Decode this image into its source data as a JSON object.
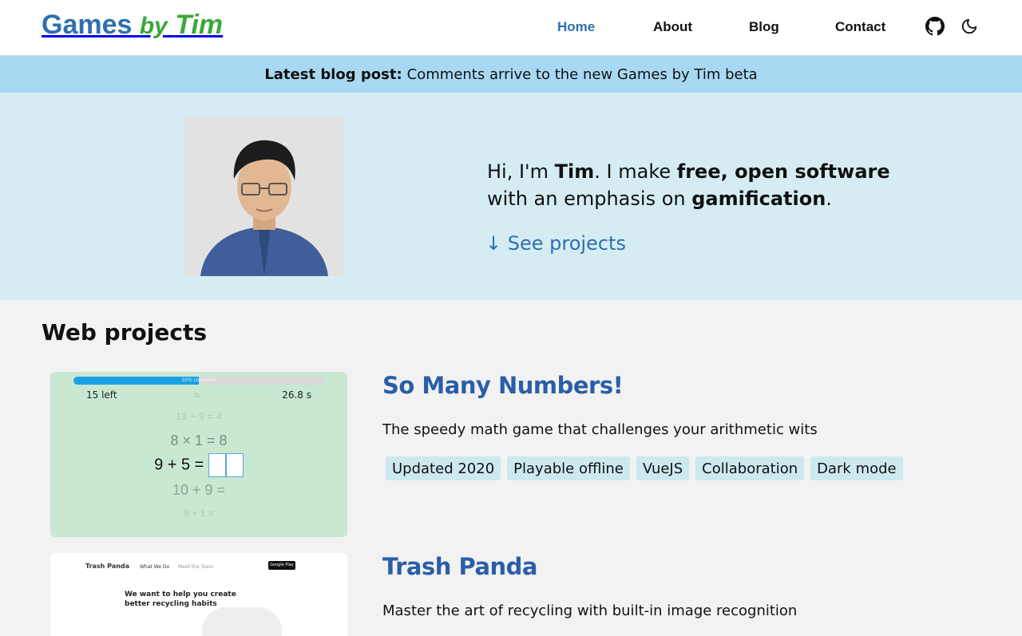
{
  "site": {
    "logo_word1": "Games",
    "logo_word2": "by",
    "logo_word3": "Tim"
  },
  "nav": {
    "items": [
      {
        "label": "Home",
        "active": true
      },
      {
        "label": "About",
        "active": false
      },
      {
        "label": "Blog",
        "active": false
      },
      {
        "label": "Contact",
        "active": false
      }
    ],
    "icons": [
      "github-icon",
      "dark-mode-moon-icon"
    ]
  },
  "banner": {
    "label": "Latest blog post:",
    "link_text": "Comments arrive to the new Games by Tim beta"
  },
  "hero": {
    "intro_1": "Hi, I'm ",
    "intro_name": "Tim",
    "intro_2": ". I make ",
    "intro_bold": "free, open software",
    "intro_3": " with an emphasis on ",
    "intro_bold2": "gamification",
    "intro_4": ".",
    "cta_arrow": "↓",
    "cta_label": "See projects"
  },
  "main": {
    "section_title": "Web projects",
    "projects": [
      {
        "title": "So Many Numbers!",
        "description": "The speedy math game that challenges your arithmetic wits",
        "tags": [
          "Updated 2020",
          "Playable offline",
          "VueJS",
          "Collaboration",
          "Dark mode"
        ],
        "thumbnail": {
          "progress_label": "50% complete",
          "progress": 0.5,
          "left_count": "15 left",
          "timer": "26.8 s",
          "eq_prev2": "13 − 9 = 4",
          "eq_prev1": "8 × 1 = 8",
          "eq_current": "9 + 5 =",
          "eq_next1": "10 + 9 =",
          "eq_next2": "8 + 1 ="
        }
      },
      {
        "title": "Trash Panda",
        "description": "Master the art of recycling with built-in image recognition",
        "thumbnail": {
          "brand": "Trash Panda",
          "nav1": "What We Do",
          "nav2": "Meet the Team",
          "store_badge": "Google Play",
          "headline": "We want to help you create better recycling habits"
        }
      }
    ]
  },
  "colors": {
    "accent_blue": "#2f6fb0",
    "logo_green": "#3aa83a",
    "banner_bg": "#a8d8f2",
    "hero_bg": "#d5edf2",
    "tag_bg": "#cce9ef"
  }
}
